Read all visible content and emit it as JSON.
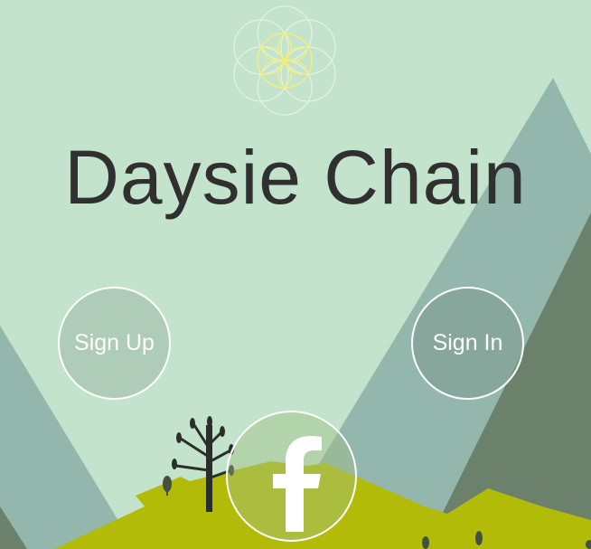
{
  "app": {
    "title": "Daysie Chain"
  },
  "buttons": {
    "sign_up_label": "Sign Up",
    "sign_in_label": "Sign In"
  },
  "icons": {
    "logo": "flower-of-life-icon",
    "facebook": "facebook-icon"
  },
  "colors": {
    "sky": "#c4e3cc",
    "mountain_light": "#93b7ad",
    "mountain_dark": "#6b816c",
    "grass": "#b2bc08",
    "title_text": "#2f302f",
    "button_outline": "#ffffff"
  }
}
